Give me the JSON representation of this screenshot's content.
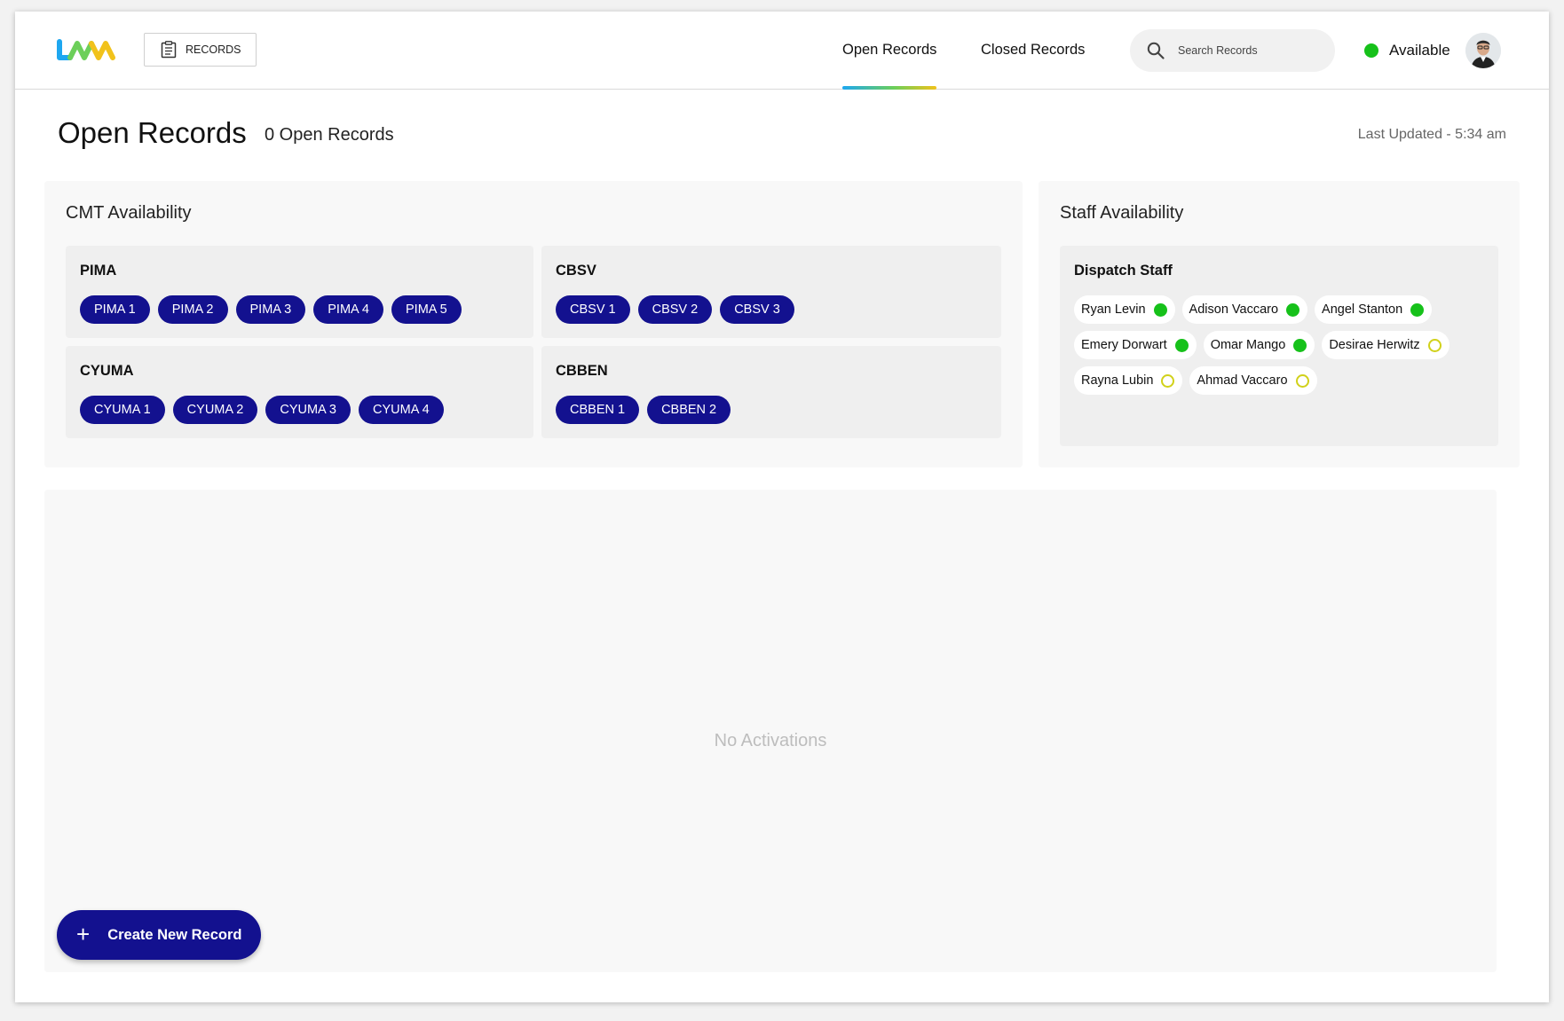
{
  "header": {
    "records_button_label": "RECORDS",
    "tabs": [
      {
        "label": "Open Records",
        "active": true
      },
      {
        "label": "Closed Records",
        "active": false
      }
    ],
    "search_placeholder": "Search Records",
    "status_label": "Available",
    "status_color": "#16c11a"
  },
  "page": {
    "title": "Open Records",
    "count_text": "0 Open Records",
    "last_updated": "Last Updated - 5:34 am"
  },
  "cmt": {
    "title": "CMT Availability",
    "groups": [
      {
        "name": "PIMA",
        "units": [
          "PIMA 1",
          "PIMA 2",
          "PIMA 3",
          "PIMA 4",
          "PIMA 5"
        ]
      },
      {
        "name": "CBSV",
        "units": [
          "CBSV 1",
          "CBSV 2",
          "CBSV 3"
        ]
      },
      {
        "name": "CYUMA",
        "units": [
          "CYUMA 1",
          "CYUMA 2",
          "CYUMA 3",
          "CYUMA 4"
        ]
      },
      {
        "name": "CBBEN",
        "units": [
          "CBBEN 1",
          "CBBEN 2"
        ]
      }
    ]
  },
  "staff": {
    "title": "Staff Availability",
    "group_title": "Dispatch Staff",
    "members": [
      {
        "name": "Ryan Levin",
        "status": "available"
      },
      {
        "name": "Adison Vaccaro",
        "status": "available"
      },
      {
        "name": "Angel Stanton",
        "status": "available"
      },
      {
        "name": "Emery Dorwart",
        "status": "available"
      },
      {
        "name": "Omar Mango",
        "status": "available"
      },
      {
        "name": "Desirae Herwitz",
        "status": "away"
      },
      {
        "name": "Rayna Lubin",
        "status": "away"
      },
      {
        "name": "Ahmad Vaccaro",
        "status": "away"
      }
    ]
  },
  "activations": {
    "empty_message": "No Activations"
  },
  "create_button_label": "Create New Record",
  "colors": {
    "primary": "#13118f",
    "available": "#16c11a",
    "away": "#d1d11a"
  }
}
